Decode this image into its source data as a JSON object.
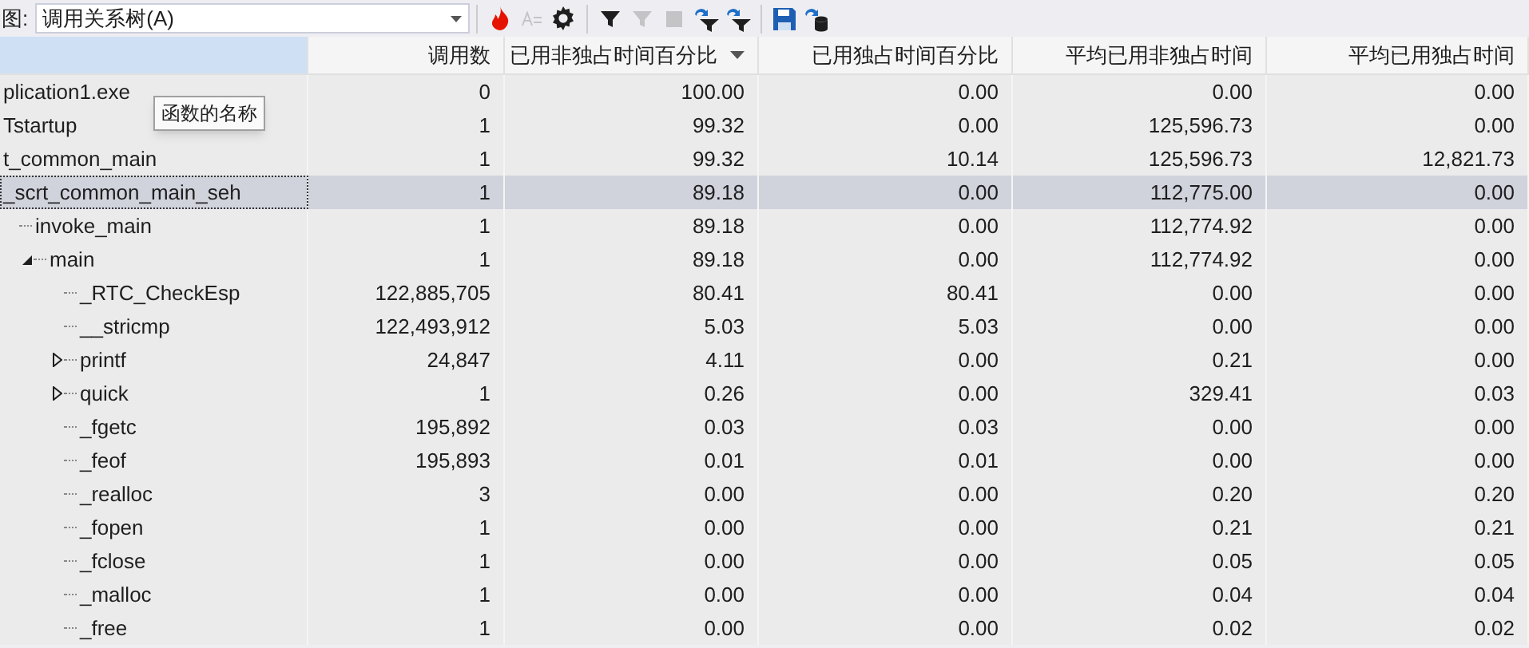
{
  "toolbar": {
    "view_label": "图:",
    "view_value": "调用关系树(A)"
  },
  "columns": [
    {
      "selected": true,
      "sorted": false
    },
    {
      "label": "调用数",
      "selected": false,
      "sorted": false
    },
    {
      "label": "已用非独占时间百分比",
      "selected": false,
      "sorted": true
    },
    {
      "label": "已用独占时间百分比",
      "selected": false,
      "sorted": false
    },
    {
      "label": "平均已用非独占时间",
      "selected": false,
      "sorted": false
    },
    {
      "label": "平均已用独占时间",
      "selected": false,
      "sorted": false
    }
  ],
  "rows": [
    {
      "name": "plication1.exe",
      "selected": false,
      "cells": [
        "0",
        "100.00",
        "0.00",
        "0.00",
        "0.00"
      ]
    },
    {
      "name": "Tstartup",
      "selected": false,
      "cells": [
        "1",
        "99.32",
        "0.00",
        "125,596.73",
        "0.00"
      ]
    },
    {
      "name": "t_common_main",
      "selected": false,
      "cells": [
        "1",
        "99.32",
        "10.14",
        "125,596.73",
        "12,821.73"
      ]
    },
    {
      "name": "_scrt_common_main_seh",
      "selected": true,
      "cells": [
        "1",
        "89.18",
        "0.00",
        "112,775.00",
        "0.00"
      ],
      "children": [
        {
          "name": "invoke_main",
          "selected": false,
          "cells": [
            "1",
            "89.18",
            "0.00",
            "112,774.92",
            "0.00"
          ],
          "children": [
            {
              "name": "main",
              "selected": false,
              "expanded": true,
              "cells": [
                "1",
                "89.18",
                "0.00",
                "112,774.92",
                "0.00"
              ],
              "children": [
                {
                  "name": "_RTC_CheckEsp",
                  "selected": false,
                  "cells": [
                    "122,885,705",
                    "80.41",
                    "80.41",
                    "0.00",
                    "0.00"
                  ]
                },
                {
                  "name": "__stricmp",
                  "selected": false,
                  "cells": [
                    "122,493,912",
                    "5.03",
                    "5.03",
                    "0.00",
                    "0.00"
                  ]
                },
                {
                  "name": "printf",
                  "selected": false,
                  "expanded": false,
                  "cells": [
                    "24,847",
                    "4.11",
                    "0.00",
                    "0.21",
                    "0.00"
                  ]
                },
                {
                  "name": "quick",
                  "selected": false,
                  "expanded": false,
                  "cells": [
                    "1",
                    "0.26",
                    "0.00",
                    "329.41",
                    "0.03"
                  ]
                },
                {
                  "name": "_fgetc",
                  "selected": false,
                  "cells": [
                    "195,892",
                    "0.03",
                    "0.03",
                    "0.00",
                    "0.00"
                  ]
                },
                {
                  "name": "_feof",
                  "selected": false,
                  "cells": [
                    "195,893",
                    "0.01",
                    "0.01",
                    "0.00",
                    "0.00"
                  ]
                },
                {
                  "name": "_realloc",
                  "selected": false,
                  "cells": [
                    "3",
                    "0.00",
                    "0.00",
                    "0.20",
                    "0.20"
                  ]
                },
                {
                  "name": "_fopen",
                  "selected": false,
                  "cells": [
                    "1",
                    "0.00",
                    "0.00",
                    "0.21",
                    "0.21"
                  ]
                },
                {
                  "name": "_fclose",
                  "selected": false,
                  "cells": [
                    "1",
                    "0.00",
                    "0.00",
                    "0.05",
                    "0.05"
                  ]
                },
                {
                  "name": "_malloc",
                  "selected": false,
                  "cells": [
                    "1",
                    "0.00",
                    "0.00",
                    "0.04",
                    "0.04"
                  ]
                },
                {
                  "name": "_free",
                  "selected": false,
                  "cells": [
                    "1",
                    "0.00",
                    "0.00",
                    "0.02",
                    "0.02"
                  ]
                }
              ]
            }
          ]
        }
      ]
    }
  ],
  "tooltip": "函数的名称"
}
